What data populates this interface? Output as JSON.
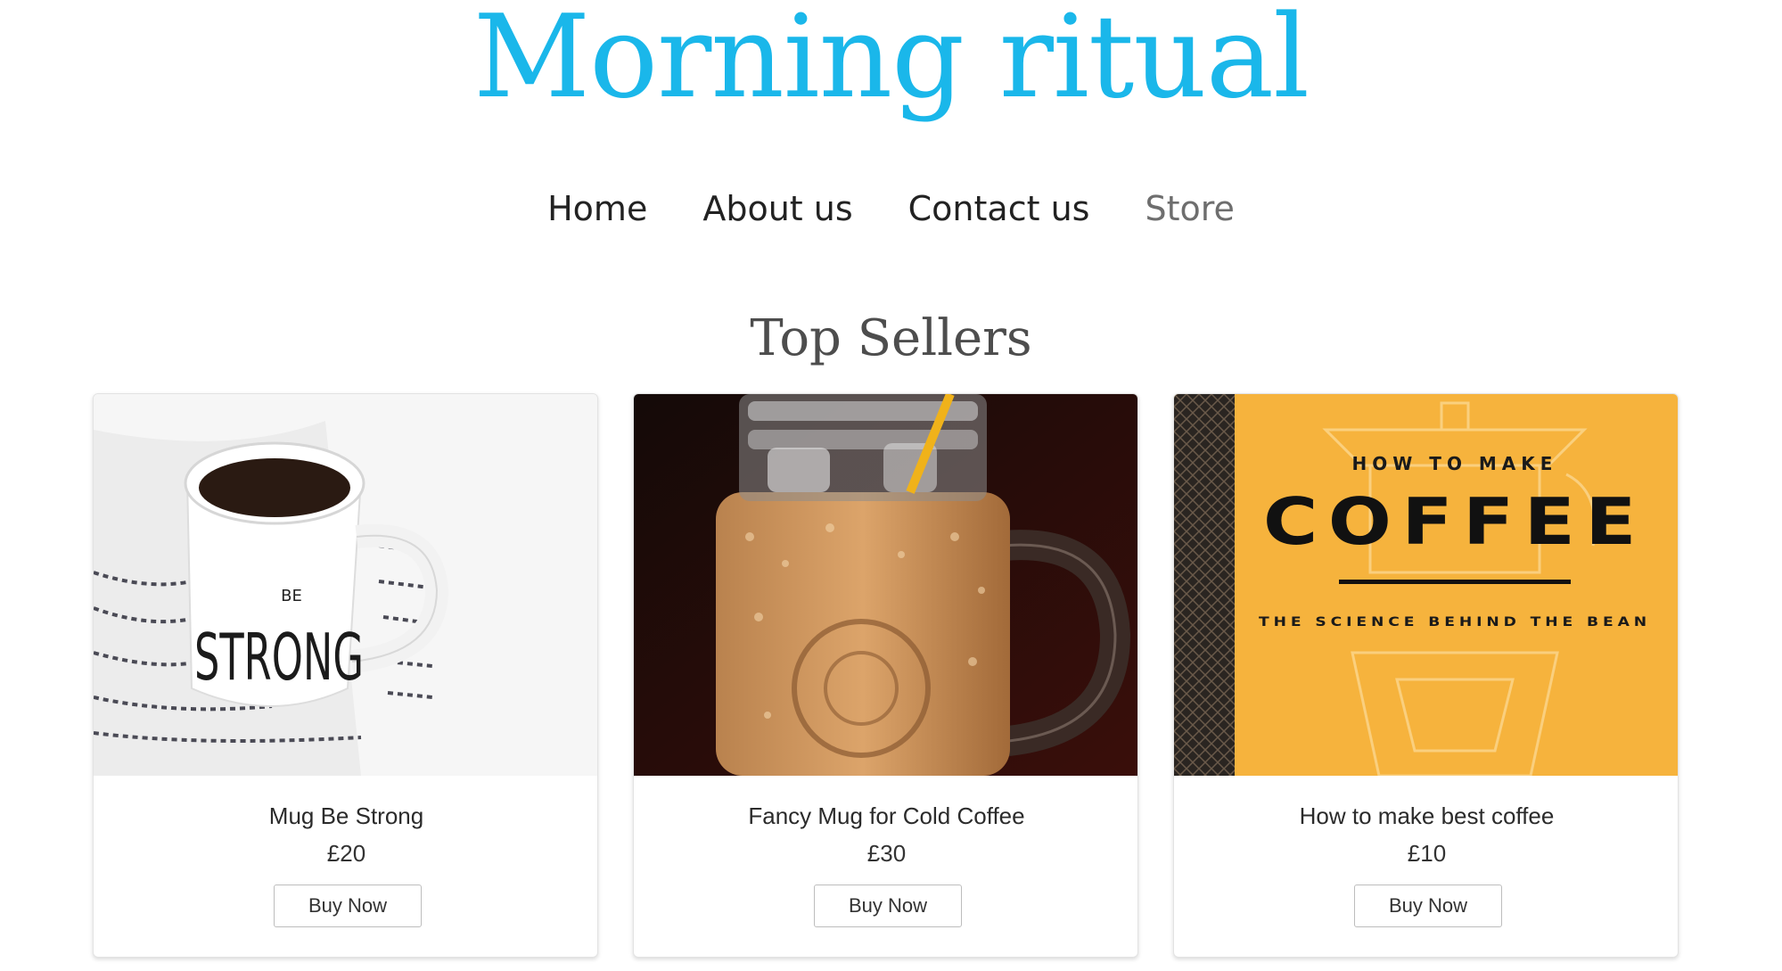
{
  "site": {
    "title": "Morning ritual"
  },
  "nav": {
    "items": [
      {
        "label": "Home",
        "active": false
      },
      {
        "label": "About us",
        "active": false
      },
      {
        "label": "Contact us",
        "active": false
      },
      {
        "label": "Store",
        "active": true
      }
    ]
  },
  "section": {
    "heading": "Top Sellers"
  },
  "products": [
    {
      "name": "Mug Be Strong",
      "price": "£20",
      "button": "Buy Now",
      "image": {
        "mug_text_small": "BE",
        "mug_text_large": "STRONG"
      }
    },
    {
      "name": "Fancy Mug for Cold Coffee",
      "price": "£30",
      "button": "Buy Now",
      "image": {}
    },
    {
      "name": "How to make best coffee",
      "price": "£10",
      "button": "Buy Now",
      "image": {
        "book_line1": "HOW TO MAKE",
        "book_line2": "COFFEE",
        "book_line3": "THE SCIENCE BEHIND THE BEAN"
      }
    }
  ],
  "colors": {
    "brand": "#1ab7ea",
    "book_cover": "#f6b33d",
    "nav_text": "#222222",
    "nav_active": "#6e6e6e"
  }
}
